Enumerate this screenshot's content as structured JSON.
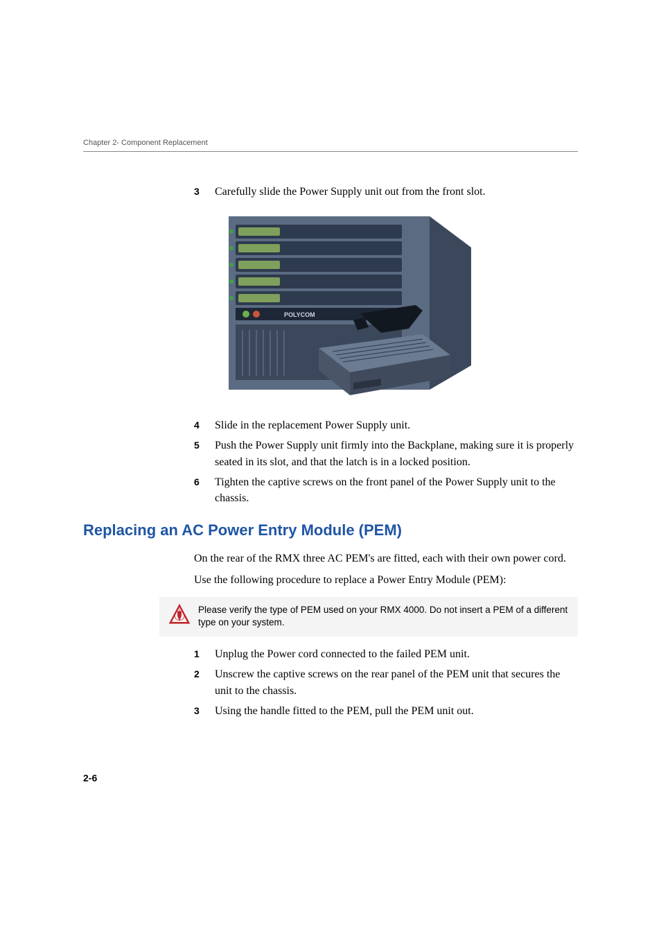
{
  "running_head": "Chapter 2- Component Replacement",
  "steps_a": [
    {
      "num": "3",
      "text": "Carefully slide the Power Supply unit out from the front slot."
    }
  ],
  "steps_b": [
    {
      "num": "4",
      "text": "Slide in the replacement Power Supply unit."
    },
    {
      "num": "5",
      "text": "Push the Power Supply unit firmly into the Backplane, making sure it is properly seated in its slot, and that the latch is in a locked position."
    },
    {
      "num": "6",
      "text": "Tighten the captive screws on the front panel of the Power Supply unit to the chassis."
    }
  ],
  "heading": "Replacing an AC Power Entry Module (PEM)",
  "intro_paras": [
    "On the rear of the RMX three AC PEM's are fitted, each with their own power cord.",
    "Use the following procedure to replace a Power Entry Module (PEM):"
  ],
  "note_text": "Please verify the type of PEM used on your RMX 4000. Do not insert a PEM of a different type on your system.",
  "steps_c": [
    {
      "num": "1",
      "text": "Unplug the Power cord connected to the failed PEM unit."
    },
    {
      "num": "2",
      "text": "Unscrew the captive screws on the rear panel of the PEM unit that secures the unit to the chassis."
    },
    {
      "num": "3",
      "text": "Using the handle fitted to the PEM, pull the PEM unit out."
    }
  ],
  "figure_label": "POLYCOM",
  "page_number": "2-6"
}
